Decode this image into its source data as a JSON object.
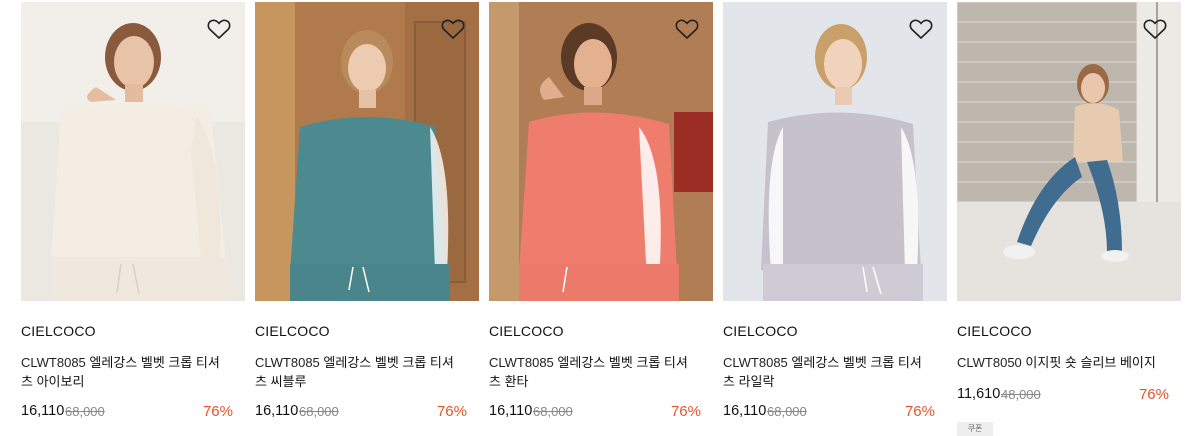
{
  "products": [
    {
      "brand": "CIELCOCO",
      "code": "CLWT8085",
      "name": "엘레강스 벨벳 크롭 티셔츠 아이보리",
      "price": "16,110",
      "original_price": "68,000",
      "discount": "76%",
      "colors": {
        "bg": "#eeebe6",
        "top": "#f4ede3",
        "bottom": "#f1ebe2"
      }
    },
    {
      "brand": "CIELCOCO",
      "code": "CLWT8085",
      "name": "엘레강스 벨벳 크롭 티셔츠 씨블루",
      "price": "16,110",
      "original_price": "68,000",
      "discount": "76%",
      "colors": {
        "bg": "#b98658",
        "top": "#4d8a90",
        "bottom": "#4b878d"
      }
    },
    {
      "brand": "CIELCOCO",
      "code": "CLWT8085",
      "name": "엘레강스 벨벳 크롭 티셔츠 환타",
      "price": "16,110",
      "original_price": "68,000",
      "discount": "76%",
      "colors": {
        "bg": "#b48057",
        "top": "#ef7d6d",
        "bottom": "#ec7a6b"
      }
    },
    {
      "brand": "CIELCOCO",
      "code": "CLWT8085",
      "name": "엘레강스 벨벳 크롭 티셔츠 라일락",
      "price": "16,110",
      "original_price": "68,000",
      "discount": "76%",
      "colors": {
        "bg": "#e3e6ea",
        "top": "#c6c2cc",
        "bottom": "#cfcbd4"
      }
    },
    {
      "brand": "CIELCOCO",
      "code": "CLWT8050",
      "name": "이지핏 숏 슬리브 베이지",
      "price": "11,610",
      "original_price": "48,000",
      "discount": "76%",
      "coupon": "쿠폰",
      "colors": {
        "bg": "#c9c4bb",
        "top": "#e6cbb0",
        "bottom": "#3f6c8f"
      }
    }
  ],
  "icons": {
    "wishlist": "heart-outline-icon"
  },
  "accent": "#e8532c"
}
